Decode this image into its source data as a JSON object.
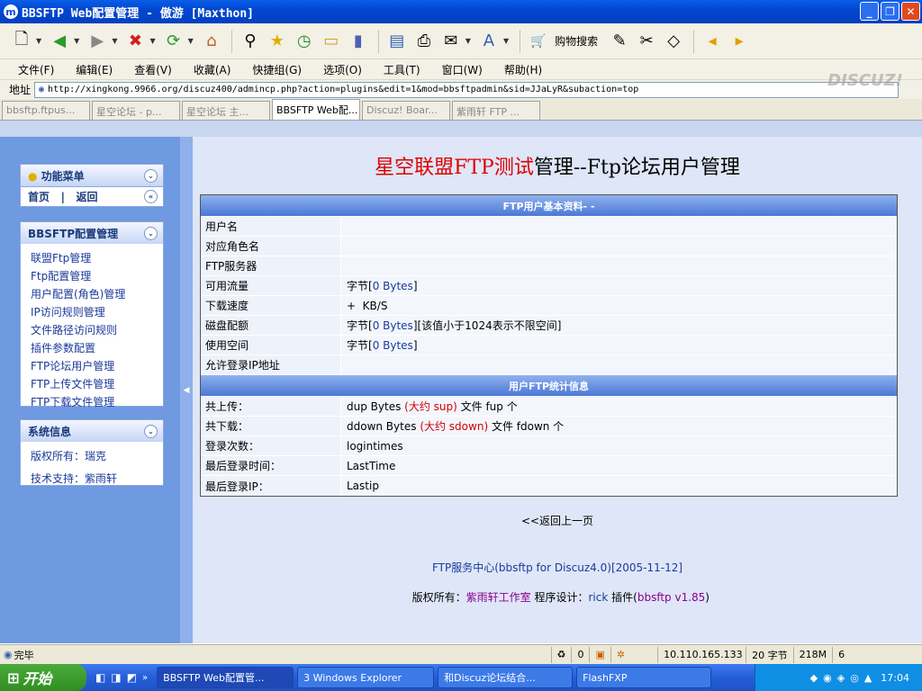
{
  "window": {
    "title": "BBSFTP Web配置管理 - 傲游 [Maxthon]",
    "app_icon": "m"
  },
  "toolbar": {
    "shopping_label": "购物搜索"
  },
  "menubar": [
    "文件(F)",
    "编辑(E)",
    "查看(V)",
    "收藏(A)",
    "快捷组(G)",
    "选项(O)",
    "工具(T)",
    "窗口(W)",
    "帮助(H)"
  ],
  "address": {
    "label": "地址",
    "url": "http://xingkong.9966.org/discuz400/admincp.php?action=plugins&edit=1&mod=bbsftpadmin&sid=JJaLyR&subaction=top"
  },
  "tabs": [
    {
      "label": "bbsftp.ftpus...",
      "active": false
    },
    {
      "label": "星空论坛 - p...",
      "active": false
    },
    {
      "label": "星空论坛 主...",
      "active": false
    },
    {
      "label": "BBSFTP Web配...",
      "active": true
    },
    {
      "label": "Discuz! Boar...",
      "active": false
    },
    {
      "label": "紫雨轩 FTP ...",
      "active": false
    }
  ],
  "sidebar": {
    "function_menu": {
      "title": "功能菜单",
      "home": "首页",
      "sep": "|",
      "back": "返回"
    },
    "config": {
      "title": "BBSFTP配置管理",
      "items": [
        "联盟Ftp管理",
        "Ftp配置管理",
        "用户配置(角色)管理",
        "IP访问规则管理",
        "文件路径访问规则",
        "插件参数配置",
        "FTP论坛用户管理",
        "FTP上传文件管理",
        "FTP下载文件管理"
      ]
    },
    "sysinfo": {
      "title": "系统信息",
      "items": [
        "版权所有：瑞克",
        "技术支持：紫雨轩"
      ]
    }
  },
  "main": {
    "title_red": "星空联盟FTP测试",
    "title_black": "管理--Ftp论坛用户管理",
    "basic_header": "FTP用户基本资料- -",
    "basic_rows": [
      {
        "label": "用户名"
      },
      {
        "label": "对应角色名"
      },
      {
        "label": "FTP服务器"
      },
      {
        "label": "可用流量",
        "pre": "字节[",
        "blue": "0 Bytes",
        "post": "]"
      },
      {
        "label": "下载速度",
        "text": "+  KB/S"
      },
      {
        "label": "磁盘配额",
        "pre": "字节[",
        "blue": "0 Bytes",
        "post": "][该值小于1024表示不限空间]"
      },
      {
        "label": "使用空间",
        "pre": "字节[",
        "blue": "0 Bytes",
        "post": "]"
      },
      {
        "label": "允许登录IP地址"
      }
    ],
    "stats_header": "用户FTP统计信息",
    "stats_rows": [
      {
        "label": "共上传：",
        "pre": "dup Bytes ",
        "red": "(大约 sup)",
        "post": " 文件 fup 个"
      },
      {
        "label": "共下载：",
        "pre": "ddown Bytes ",
        "red": "(大约 sdown)",
        "post": " 文件 fdown 个"
      },
      {
        "label": "登录次数：",
        "text": "logintimes"
      },
      {
        "label": "最后登录时间：",
        "text": "LastTime"
      },
      {
        "label": "最后登录IP：",
        "text": "Lastip"
      }
    ],
    "back_link": "<<返回上一页",
    "footer_line1": "FTP服务中心(bbsftp for Discuz4.0)[2005-11-12]",
    "footer_copyright": "版权所有：",
    "footer_studio": "紫雨轩工作室",
    "footer_designer_label": " 程序设计：",
    "footer_designer": "rick",
    "footer_plugin_label": " 插件(",
    "footer_plugin": "bbsftp v1.85",
    "footer_close": ")"
  },
  "status": {
    "text": "完毕",
    "count": "0",
    "ip": "10.110.165.133",
    "bytes": "20 字节",
    "mem": "218M",
    "num": "6"
  },
  "taskbar": {
    "start": "开始",
    "tasks": [
      {
        "label": "BBSFTP Web配置管...",
        "active": true
      },
      {
        "label": "3 Windows Explorer",
        "active": false
      },
      {
        "label": "和Discuz论坛结合...",
        "active": false
      },
      {
        "label": "FlashFXP",
        "active": false
      }
    ],
    "clock": "17:04"
  },
  "watermark": "DISCUZ!",
  "colors": {
    "accent": "#0a5ee8",
    "title_red": "#e00000",
    "link_blue": "#1a3a9a",
    "header_blue": "#4a78d6"
  }
}
